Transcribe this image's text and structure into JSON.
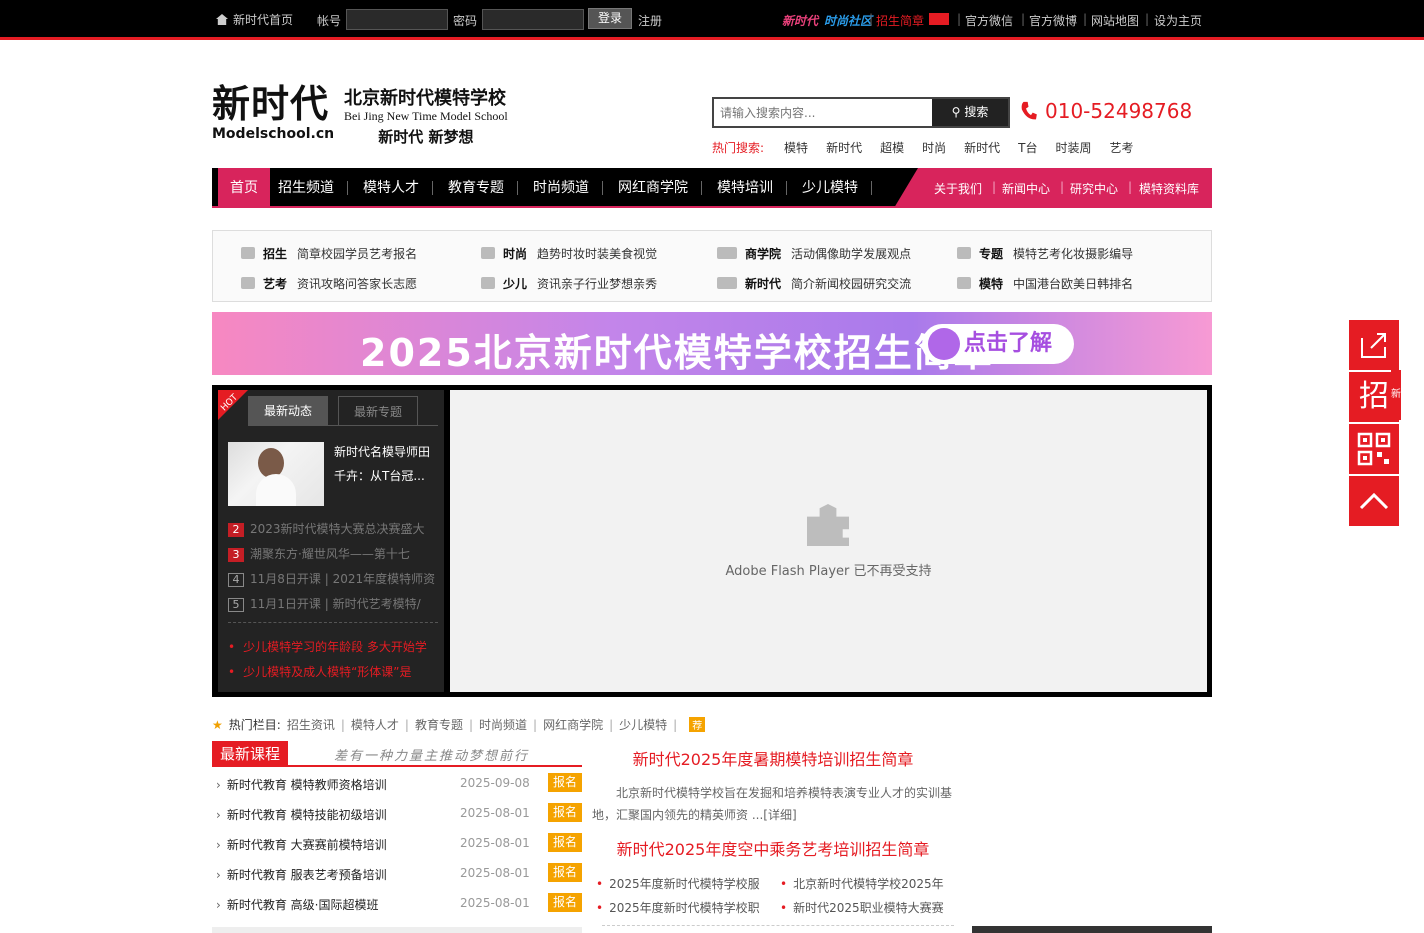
{
  "topbar": {
    "home": "新时代首页",
    "account_label": "帐号",
    "password_label": "密码",
    "login": "登录",
    "register": "注册",
    "brand1": "新时代",
    "brand2": "时尚社区",
    "enroll": "招生简章",
    "wechat": "官方微信",
    "weibo": "官方微博",
    "sitemap": "网站地图",
    "homepage": "设为主页"
  },
  "logo": {
    "big": "新时代",
    "en": "Modelschool.cn",
    "school": "北京新时代模特学校",
    "school_en": "Bei Jing New Time Model School",
    "slogan": "新时代 新梦想"
  },
  "search": {
    "placeholder": "请输入搜索内容...",
    "button": "搜索"
  },
  "phone": "010-52498768",
  "hot_search": {
    "label": "热门搜索:",
    "items": [
      "模特",
      "新时代",
      "超模",
      "时尚",
      "新时代",
      "T台",
      "时装周",
      "艺考"
    ]
  },
  "nav": {
    "items": [
      "首页",
      "招生频道",
      "模特人才",
      "教育专题",
      "时尚频道",
      "网红商学院",
      "模特培训",
      "少儿模特"
    ],
    "right": [
      "关于我们",
      "新闻中心",
      "研究中心",
      "模特资料库"
    ]
  },
  "categories": [
    {
      "title": "招生",
      "words": [
        "简章",
        "校园",
        "学员",
        "艺考",
        "报名"
      ]
    },
    {
      "title": "时尚",
      "words": [
        "趋势",
        "时妆",
        "时装",
        "美食",
        "视觉"
      ]
    },
    {
      "title": "商学院",
      "words": [
        "活动",
        "偶像",
        "助学",
        "发展",
        "观点"
      ]
    },
    {
      "title": "专题",
      "words": [
        "模特",
        "艺考",
        "化妆",
        "摄影",
        "编导"
      ]
    },
    {
      "title": "艺考",
      "words": [
        "资讯",
        "攻略",
        "问答",
        "家长",
        "志愿"
      ]
    },
    {
      "title": "少儿",
      "words": [
        "资讯",
        "亲子",
        "行业",
        "梦想",
        "亲秀"
      ]
    },
    {
      "title": "新时代",
      "words": [
        "简介",
        "新闻",
        "校园",
        "研究",
        "交流"
      ]
    },
    {
      "title": "模特",
      "words": [
        "中国",
        "港台",
        "欧美",
        "日韩",
        "排名"
      ]
    }
  ],
  "banner": {
    "text": "2025北京新时代模特学校招生简章",
    "cta": "点击了解"
  },
  "latest": {
    "hot": "HOT",
    "tab1": "最新动态",
    "tab2": "最新专题",
    "feature_title": "新时代名模导师田千卉：从T台冠...",
    "list": [
      {
        "n": "2",
        "t": "2023新时代模特大赛总决赛盛大"
      },
      {
        "n": "3",
        "t": "潮聚东方·耀世风华——第十七"
      },
      {
        "n": "4",
        "t": "11月8日开课 | 2021年度模特师资"
      },
      {
        "n": "5",
        "t": "11月1日开课 | 新时代艺考模特/"
      }
    ],
    "red": [
      "少儿模特学习的年龄段 多大开始学",
      "少儿模特及成人模特“形体课”是"
    ]
  },
  "flash": {
    "message": "Adobe Flash Player 已不再受支持"
  },
  "hot_columns": {
    "label": "热门栏目:",
    "items": [
      "招生资讯",
      "模特人才",
      "教育专题",
      "时尚频道",
      "网红商学院",
      "少儿模特"
    ],
    "badge": "荐"
  },
  "courses": {
    "title": "最新课程",
    "slogan": "差有一种力量主推动梦想前行",
    "button": "报名",
    "rows": [
      {
        "title": "新时代教育 模特教师资格培训",
        "date": "2025-09-08"
      },
      {
        "title": "新时代教育 模特技能初级培训",
        "date": "2025-08-01"
      },
      {
        "title": "新时代教育 大赛赛前模特培训",
        "date": "2025-08-01"
      },
      {
        "title": "新时代教育 服表艺考预备培训",
        "date": "2025-08-01"
      },
      {
        "title": "新时代教育 高级·国际超模班",
        "date": "2025-08-01"
      }
    ]
  },
  "news": {
    "h1": "新时代2025年度暑期模特培训招生简章",
    "p": "北京新时代模特学校旨在发掘和培养模特表演专业人才的实训基地，汇聚国内领先的精英师资 ...[详细]",
    "h2": "新时代2025年度空中乘务艺考培训招生简章",
    "links": [
      "2025年度新时代模特学校服",
      "北京新时代模特学校2025年",
      "2025年度新时代模特学校职",
      "新时代2025职业模特大赛赛"
    ]
  },
  "float": {
    "zhao": "招",
    "xin": "新"
  }
}
